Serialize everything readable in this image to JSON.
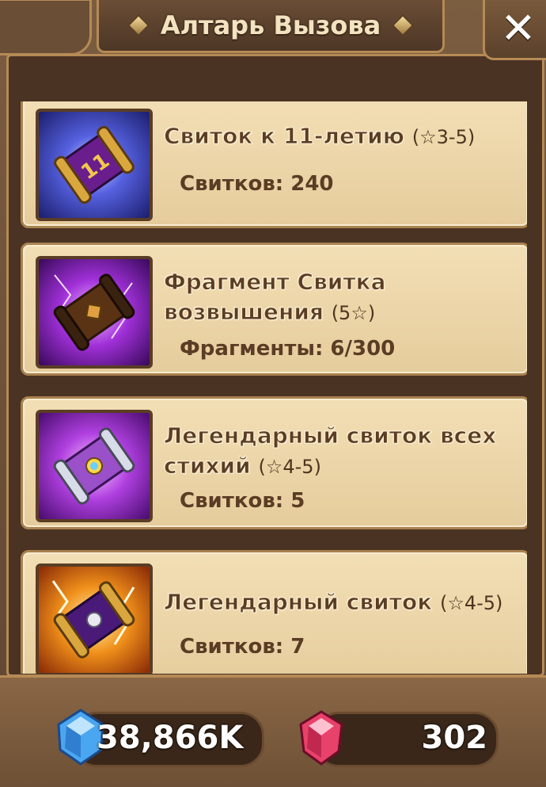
{
  "header": {
    "title": "Алтарь Вызова",
    "close_label": "✕"
  },
  "scrolls": [
    {
      "name": "Свиток к 11-летию",
      "grade": "(☆3-5)",
      "count_label": "Свитков: 240",
      "icon": "anniversary-scroll-icon",
      "icon_bg": "#3a3fb8"
    },
    {
      "name_line1": "Фрагмент Свитка",
      "name_line2": "возвышения",
      "grade": "(5☆)",
      "count_label": "Фрагменты: 6/300",
      "icon": "transcendence-scroll-fragment-icon",
      "icon_bg": "#7a1fb5"
    },
    {
      "name_line1": "Легендарный свиток всех",
      "name_line2": "стихий",
      "grade": "(☆4-5)",
      "count_label": "Свитков: 5",
      "icon": "legendary-all-attribute-scroll-icon",
      "icon_bg": "#8a1fc2"
    },
    {
      "name": "Легендарный свиток",
      "grade": "(☆4-5)",
      "count_label": "Свитков: 7",
      "icon": "legendary-scroll-icon",
      "icon_bg": "#e07a12"
    }
  ],
  "footer": {
    "mana_value": "38,866K",
    "mana_icon": "mana-crystal-icon",
    "crystal_value": "302",
    "crystal_icon": "crystal-icon"
  },
  "colors": {
    "frame": "#5a4330",
    "card": "#f3dfb5",
    "text": "#5a3d24",
    "mana": "#3a8ee0",
    "crystal": "#e0305a"
  }
}
